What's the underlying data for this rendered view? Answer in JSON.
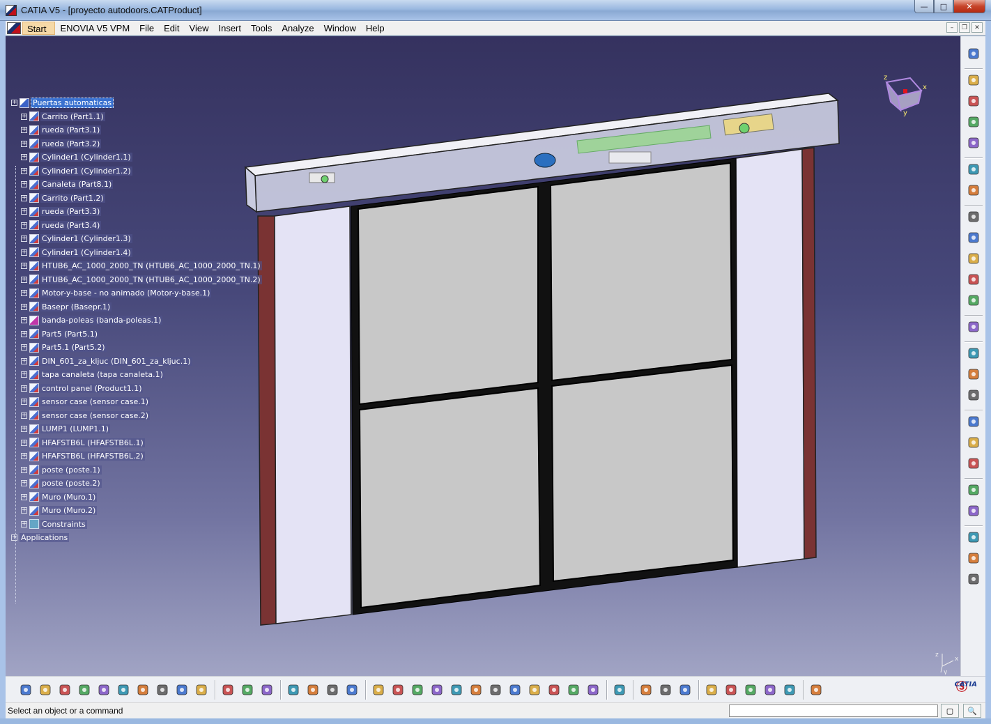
{
  "window": {
    "title": "CATIA V5 - [proyecto autodoors.CATProduct]",
    "min_glyph": "—",
    "max_glyph": "□",
    "close_glyph": "✕"
  },
  "menubar": {
    "items": [
      {
        "label": "Start"
      },
      {
        "label": "ENOVIA V5 VPM"
      },
      {
        "label": "File"
      },
      {
        "label": "Edit"
      },
      {
        "label": "View"
      },
      {
        "label": "Insert"
      },
      {
        "label": "Tools"
      },
      {
        "label": "Analyze"
      },
      {
        "label": "Window"
      },
      {
        "label": "Help"
      }
    ],
    "mdi_min": "–",
    "mdi_restore": "❐",
    "mdi_close": "✕"
  },
  "tree": {
    "root": "Puertas automaticas",
    "nodes": [
      {
        "label": "Carrito (Part1.1)",
        "icon": "part"
      },
      {
        "label": "rueda (Part3.1)",
        "icon": "part"
      },
      {
        "label": "rueda (Part3.2)",
        "icon": "part"
      },
      {
        "label": "Cylinder1 (Cylinder1.1)",
        "icon": "part"
      },
      {
        "label": "Cylinder1 (Cylinder1.2)",
        "icon": "part"
      },
      {
        "label": "Canaleta (Part8.1)",
        "icon": "part"
      },
      {
        "label": "Carrito (Part1.2)",
        "icon": "part"
      },
      {
        "label": "rueda (Part3.3)",
        "icon": "part"
      },
      {
        "label": "rueda (Part3.4)",
        "icon": "part"
      },
      {
        "label": "Cylinder1 (Cylinder1.3)",
        "icon": "part"
      },
      {
        "label": "Cylinder1 (Cylinder1.4)",
        "icon": "part"
      },
      {
        "label": "HTUB6_AC_1000_2000_TN (HTUB6_AC_1000_2000_TN.1)",
        "icon": "part"
      },
      {
        "label": "HTUB6_AC_1000_2000_TN (HTUB6_AC_1000_2000_TN.2)",
        "icon": "part"
      },
      {
        "label": "Motor-y-base - no animado (Motor-y-base.1)",
        "icon": "part"
      },
      {
        "label": "Basepr (Basepr.1)",
        "icon": "part"
      },
      {
        "label": "banda-poleas (banda-poleas.1)",
        "icon": "banda"
      },
      {
        "label": "Part5 (Part5.1)",
        "icon": "part"
      },
      {
        "label": "Part5.1 (Part5.2)",
        "icon": "part"
      },
      {
        "label": "DIN_601_za_kljuc (DIN_601_za_kljuc.1)",
        "icon": "part"
      },
      {
        "label": "tapa canaleta (tapa canaleta.1)",
        "icon": "part"
      },
      {
        "label": "control panel (Product1.1)",
        "icon": "part"
      },
      {
        "label": "sensor case (sensor case.1)",
        "icon": "part"
      },
      {
        "label": "sensor case (sensor case.2)",
        "icon": "part"
      },
      {
        "label": "LUMP1 (LUMP1.1)",
        "icon": "part"
      },
      {
        "label": "HFAFSTB6L (HFAFSTB6L.1)",
        "icon": "part"
      },
      {
        "label": "HFAFSTB6L (HFAFSTB6L.2)",
        "icon": "part"
      },
      {
        "label": "poste (poste.1)",
        "icon": "part"
      },
      {
        "label": "poste (poste.2)",
        "icon": "part"
      },
      {
        "label": "Muro (Muro.1)",
        "icon": "part"
      },
      {
        "label": "Muro (Muro.2)",
        "icon": "part"
      },
      {
        "label": "Constraints",
        "icon": "constraints"
      }
    ],
    "applications": "Applications"
  },
  "compass": {
    "x_label": "x",
    "y_label": "y",
    "z_label": "z"
  },
  "axis_triad": {
    "x_label": "x",
    "y_label": "y",
    "z_label": "z"
  },
  "right_toolbar": {
    "icons": [
      "fly-mode-icon",
      "part-design-icon",
      "assembly-icon",
      "drafting-icon",
      "kinematics-icon",
      "select-arrow-icon",
      "select-trap-icon",
      "update-icon",
      "move-icon",
      "component-icon",
      "snap-icon",
      "constraint-icon",
      "analysis-icon",
      "manipulation-icon",
      "catalog-icon",
      "render-icon",
      "clash-icon",
      "measure-icon",
      "tools-icon",
      "section-icon",
      "apply-material-icon",
      "sketch-tracer-icon",
      "publish-icon",
      "spin-icon"
    ]
  },
  "bottom_toolbar": {
    "icons": [
      "new-icon",
      "open-icon",
      "save-icon",
      "print-icon",
      "cut-icon",
      "copy-icon",
      "paste-icon",
      "undo-icon",
      "redo-icon",
      "whats-this-icon",
      "formula-icon",
      "comment-icon",
      "lock-icon",
      "table-icon",
      "graph-icon",
      "macro-icon",
      "matrix-icon",
      "fly-icon",
      "fit-all-icon",
      "pan-icon",
      "rotate-icon",
      "zoom-in-icon",
      "zoom-out-icon",
      "normal-view-icon",
      "multi-view-icon",
      "iso-view-icon",
      "hide-show-icon",
      "shading-icon",
      "render-style-icon",
      "capture-icon",
      "compass-icon",
      "prev-icon",
      "next-icon",
      "search-icon",
      "measure-between-icon",
      "illumination-icon",
      "lighting-icon",
      "distance-icon",
      "knowledge-icon"
    ],
    "brand": "CATIA"
  },
  "statusbar": {
    "message": "Select an object or a command",
    "command_value": ""
  }
}
